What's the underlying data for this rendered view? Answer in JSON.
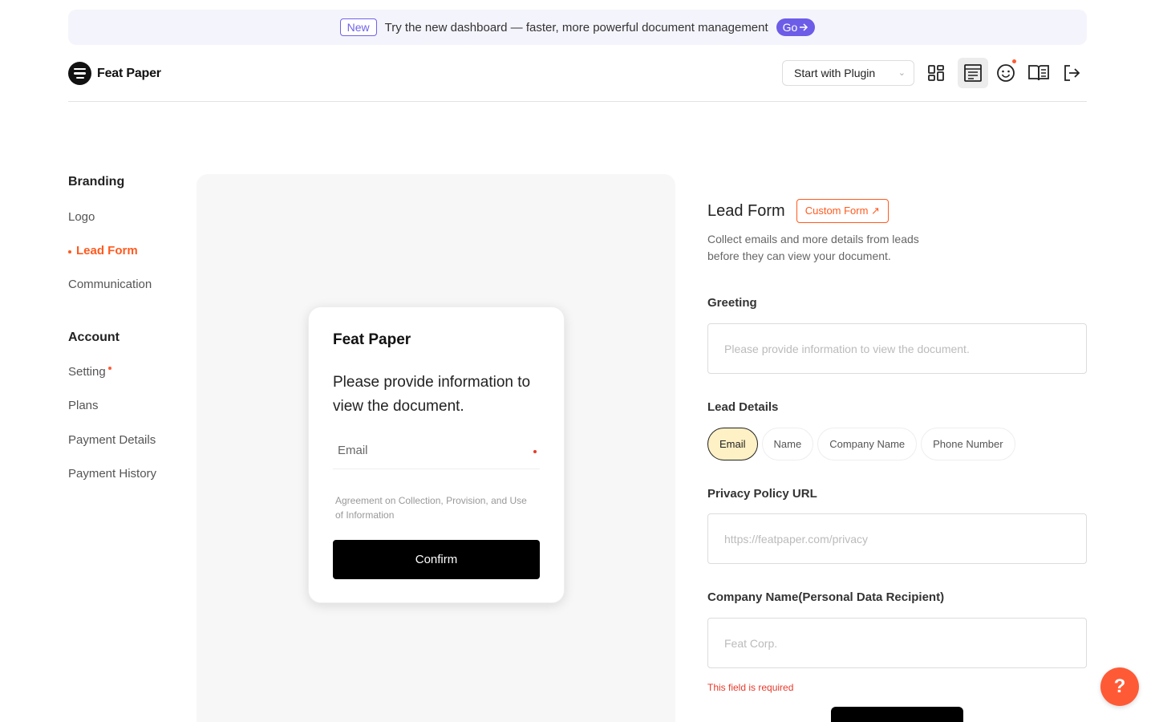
{
  "banner": {
    "badge": "New",
    "text": "Try the new dashboard — faster, more powerful document management",
    "go_label": "Go",
    "go_icon": "arrow-right-icon"
  },
  "header": {
    "brand": "Feat Paper",
    "plugin_select": "Start with Plugin",
    "icons": [
      "grid-icon",
      "document-icon",
      "smiley-icon",
      "book-icon",
      "logout-icon"
    ],
    "accent_color": "#ff5a36"
  },
  "sidebar": {
    "section1": "Branding",
    "items1": [
      "Logo",
      "Lead Form",
      "Communication"
    ],
    "section2": "Account",
    "items2": [
      "Setting",
      "Plans",
      "Payment Details",
      "Payment History"
    ]
  },
  "preview": {
    "brand": "Feat Paper",
    "message": "Please provide information to view the document.",
    "email_placeholder": "Email",
    "agreement": "Agreement on Collection, Provision, and Use of Information",
    "confirm_label": "Confirm"
  },
  "form": {
    "title": "Lead Form",
    "custom_form_label": "Custom Form ↗",
    "description": "Collect emails and more details from leads before they can view your document.",
    "greeting_label": "Greeting",
    "greeting_placeholder": "Please provide information to view the document.",
    "lead_details_label": "Lead Details",
    "lead_details": [
      "Email",
      "Name",
      "Company Name",
      "Phone Number"
    ],
    "selected_detail": "Email",
    "privacy_label": "Privacy Policy URL",
    "privacy_placeholder": "https://featpaper.com/privacy",
    "company_label": "Company Name(Personal Data Recipient)",
    "company_placeholder": "Feat Corp.",
    "error_text": "This field is required"
  },
  "help": {
    "label": "?"
  }
}
